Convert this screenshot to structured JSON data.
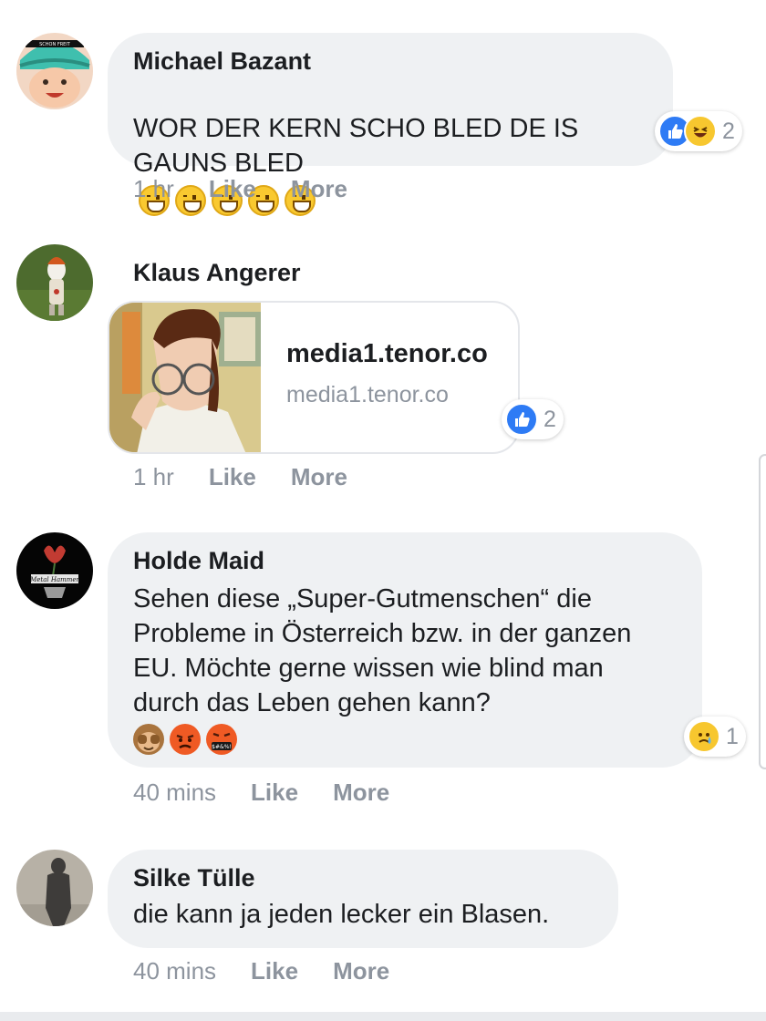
{
  "comments": [
    {
      "author": "Michael Bazant",
      "text": "WOR DER KERN SCHO BLED DE IS\nGAUNS BLED",
      "emoji_names": [
        "grinning-face",
        "grinning-face",
        "grinning-face",
        "grinning-face",
        "grinning-face"
      ],
      "time": "1 hr",
      "like_label": "Like",
      "more_label": "More",
      "reactions": {
        "types": [
          "like",
          "haha"
        ],
        "count": "2"
      },
      "avatar_text": "SCHON FREIT"
    },
    {
      "author": "Klaus Angerer",
      "link": {
        "title": "media1.tenor.co",
        "domain": "media1.tenor.co"
      },
      "time": "1 hr",
      "like_label": "Like",
      "more_label": "More",
      "reactions": {
        "types": [
          "like"
        ],
        "count": "2"
      }
    },
    {
      "author": "Holde Maid",
      "text": "Sehen diese „Super-Gutmenschen“ die Probleme in Österreich bzw. in der ganzen EU. Möchte gerne wissen wie blind man durch das Leben gehen kann?",
      "emoji_names": [
        "see-no-evil-monkey",
        "pouting-face",
        "face-with-symbols-on-mouth"
      ],
      "emoji_symbol_text": "$#&%!",
      "time": "40 mins",
      "like_label": "Like",
      "more_label": "More",
      "reactions": {
        "types": [
          "sad"
        ],
        "count": "1"
      },
      "avatar_text": "Metal Hammer"
    },
    {
      "author": "Silke Tülle",
      "text": "die kann ja jeden lecker ein Blasen.",
      "time": "40 mins",
      "like_label": "Like",
      "more_label": "More"
    }
  ],
  "colors": {
    "bubble": "#eff1f3",
    "meta_text": "#8d949e",
    "like_blue": "#2e7bf5",
    "emoji_yellow": "#f7c72f"
  }
}
